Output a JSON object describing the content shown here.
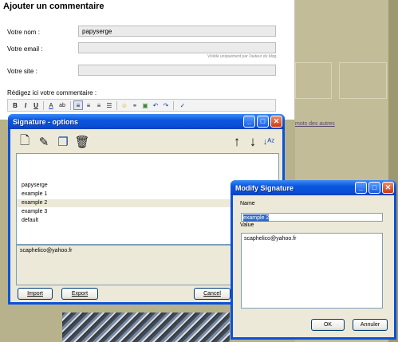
{
  "background": {
    "link_text": "mots des autres"
  },
  "comment_form": {
    "title": "Ajouter un commentaire",
    "name_label": "Votre nom :",
    "name_value": "papyserge",
    "email_label": "Votre email :",
    "email_value": "",
    "email_hint": "Visible uniquement par l'auteur du blog.",
    "site_label": "Votre site :",
    "site_value": "",
    "comment_label": "Rédigez ici votre commentaire :",
    "toolbar": [
      "B",
      "I",
      "U",
      "A",
      "ab",
      "≡",
      "≡",
      "≡",
      "☰",
      "☺",
      "⚭",
      "▣",
      "↶",
      "↷",
      "✓"
    ]
  },
  "signature_window": {
    "title": "Signature - options",
    "toolbar_icons": [
      "new-document-icon",
      "edit-document-icon",
      "copy-icon",
      "delete-icon",
      "move-up-icon",
      "move-down-icon",
      "sort-az-icon"
    ],
    "items": [
      "papyserge",
      "example 1",
      "example 2",
      "example 3",
      "default"
    ],
    "selected_index": 2,
    "selected_value": "scaphelico@yahoo.fr",
    "import_label": "Import",
    "export_label": "Export",
    "cancel_label": "Cancel"
  },
  "modify_window": {
    "title": "Modify Signature",
    "name_label": "Name",
    "name_value": "example 2",
    "value_label": "Value",
    "value_text": "scaphelico@yahoo.fr",
    "ok_label": "OK",
    "cancel_label": "Annuler"
  },
  "colors": {
    "xp_blue": "#0a52dc",
    "selection": "#316ac5",
    "window_face": "#ece9d8"
  }
}
